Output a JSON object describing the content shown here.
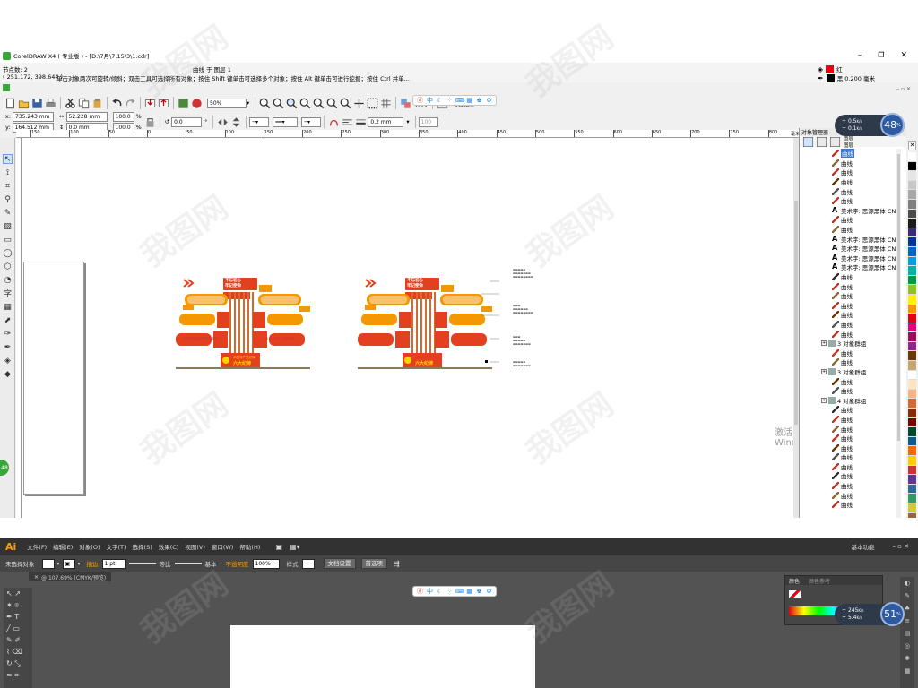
{
  "cdr": {
    "title": "CorelDRAW X4 ( 专业版 ) - [D:\\7月\\7.15\\3\\1.cdr]",
    "status": {
      "node_count": "节点数: 2",
      "curve_layer": "曲线 于 图层 1",
      "coords": "( 251.172, 398.644 )",
      "hint": "单击对象两次可旋转/倾斜；双击工具可选择所有对象；按住 Shift 键单击可选择多个对象；按住 Alt 键单击可进行挖掘；按住 Ctrl 并单...",
      "fill_label": "红",
      "outline_label": "黑 0.200 毫米"
    },
    "toolbar": {
      "zoom": "50%",
      "arrange_label": "排列",
      "weld_label": "增强插件"
    },
    "props": {
      "x": "735.243 mm",
      "y": "164.512 mm",
      "w": "52.228 mm",
      "h": "0.0 mm",
      "sx": "100.0",
      "sy": "100.0",
      "pct1": "%",
      "pct2": "%",
      "angle": "0.0",
      "outline_w": "0.2 mm",
      "num": "100"
    },
    "ruler": {
      "ticks": [
        "150",
        "100",
        "50",
        "0",
        "50",
        "100",
        "150",
        "200",
        "250",
        "300",
        "350",
        "400",
        "450",
        "500",
        "550",
        "600",
        "650",
        "700",
        "750",
        "800",
        "850",
        "900"
      ],
      "unit": "毫米"
    },
    "docker": {
      "title": "对象管理器",
      "items": [
        {
          "label": "曲线",
          "kind": "curve",
          "selected": true
        },
        {
          "label": "曲线",
          "kind": "curve"
        },
        {
          "label": "曲线",
          "kind": "curve"
        },
        {
          "label": "曲线",
          "kind": "curve"
        },
        {
          "label": "曲线",
          "kind": "curve"
        },
        {
          "label": "曲线",
          "kind": "curve"
        },
        {
          "label": "美术字:  思源黑体 CN",
          "kind": "text"
        },
        {
          "label": "曲线",
          "kind": "curve"
        },
        {
          "label": "曲线",
          "kind": "curve"
        },
        {
          "label": "美术字:  思源黑体 CN",
          "kind": "text"
        },
        {
          "label": "美术字:  思源黑体 CN",
          "kind": "text"
        },
        {
          "label": "美术字:  思源黑体 CN",
          "kind": "text"
        },
        {
          "label": "美术字:  思源黑体 CN",
          "kind": "text"
        },
        {
          "label": "曲线",
          "kind": "curve"
        },
        {
          "label": "曲线",
          "kind": "curve"
        },
        {
          "label": "曲线",
          "kind": "curve"
        },
        {
          "label": "曲线",
          "kind": "curve"
        },
        {
          "label": "曲线",
          "kind": "curve"
        },
        {
          "label": "曲线",
          "kind": "curve"
        },
        {
          "label": "曲线",
          "kind": "curve"
        },
        {
          "label": "3 对象群组",
          "kind": "group"
        },
        {
          "label": "曲线",
          "kind": "curve"
        },
        {
          "label": "曲线",
          "kind": "curve"
        },
        {
          "label": "3 对象群组",
          "kind": "group"
        },
        {
          "label": "曲线",
          "kind": "curve"
        },
        {
          "label": "曲线",
          "kind": "curve"
        },
        {
          "label": "4 对象群组",
          "kind": "group"
        },
        {
          "label": "曲线",
          "kind": "curve"
        },
        {
          "label": "曲线",
          "kind": "curve"
        },
        {
          "label": "曲线",
          "kind": "curve"
        },
        {
          "label": "曲线",
          "kind": "curve"
        },
        {
          "label": "曲线",
          "kind": "curve"
        },
        {
          "label": "曲线",
          "kind": "curve"
        },
        {
          "label": "曲线",
          "kind": "curve"
        },
        {
          "label": "曲线",
          "kind": "curve"
        },
        {
          "label": "曲线",
          "kind": "curve"
        },
        {
          "label": "曲线",
          "kind": "curve"
        },
        {
          "label": "曲线",
          "kind": "curve"
        }
      ],
      "layer_labels": [
        "图层",
        "图层"
      ]
    },
    "palette": [
      "#ffffff",
      "#000000",
      "#e5e5e5",
      "#c8c8c8",
      "#a8a8a8",
      "#7f7f7f",
      "#4a4a4a",
      "#1b1b1b",
      "#3b2a7d",
      "#0033a0",
      "#0066cc",
      "#00a0e9",
      "#00b3a4",
      "#009944",
      "#8fc31f",
      "#fff100",
      "#f39800",
      "#e60012",
      "#e4007f",
      "#a40b5d",
      "#92278f",
      "#6a3906",
      "#c4a672",
      "#ffffff",
      "#ffe4c4",
      "#f6b37f",
      "#d36a32",
      "#8c2a07",
      "#7b0000",
      "#004b28",
      "#0d5c8f",
      "#ff6600",
      "#ffcc00",
      "#cc3333",
      "#663399",
      "#336699",
      "#339966",
      "#cccc33",
      "#996633",
      "#ff9999"
    ],
    "watermark_win": "激活 Windows",
    "poster": {
      "title1": "不忘初心",
      "title2": "牢记使命",
      "banner1": "中国共产党纪律",
      "banner2": "六大纪律",
      "tag1": "四史",
      "tag2": "四中",
      "tag3": "纪律",
      "tag4": "组织",
      "tag5": "群众",
      "tag6": "工作",
      "tag7": "生活",
      "sub1": "实践中坚持党的群众路线",
      "sub2": "永远跟党走 打造铁军"
    }
  },
  "ai": {
    "logo": "Ai",
    "menu": [
      "文件(F)",
      "编辑(E)",
      "对象(O)",
      "文字(T)",
      "选择(S)",
      "效果(C)",
      "视图(V)",
      "窗口(W)",
      "帮助(H)"
    ],
    "workspace": "基本功能",
    "ctrl": {
      "no_sel": "未选择对象",
      "stroke_label": "描边",
      "stroke_val": "1 pt",
      "profile": "等比",
      "brush": "基本",
      "opacity_label": "不透明度",
      "opacity_val": "100%",
      "style_label": "样式",
      "doc_setup": "文档设置",
      "prefs": "首选项"
    },
    "tab": "@ 107.69% (CMYK/预览)",
    "color_panel": {
      "tab1": "颜色",
      "tab2": "颜色参考"
    }
  },
  "speed1": {
    "up": "0.5",
    "up_unit": "K/s",
    "down": "0.1",
    "down_unit": "K/s",
    "pct": "48",
    "pct_unit": "%"
  },
  "speed2": {
    "up": "245",
    "up_unit": "K/s",
    "down": "5.4",
    "down_unit": "K/s",
    "pct": "51",
    "pct_unit": "%"
  },
  "float_bar": {
    "icons": [
      "dou",
      "zhong",
      "moon",
      "dots",
      "keyboard",
      "grid",
      "shirt",
      "gear"
    ]
  }
}
